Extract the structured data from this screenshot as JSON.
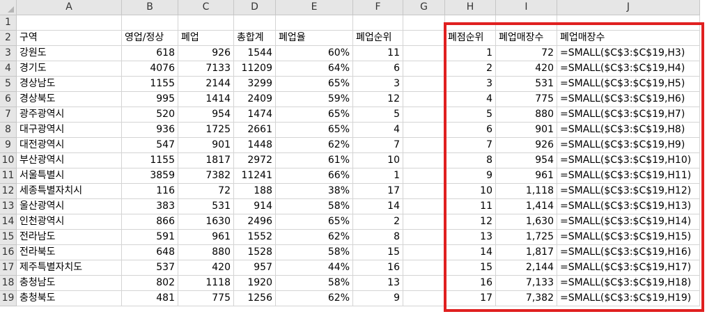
{
  "columns": [
    "A",
    "B",
    "C",
    "D",
    "E",
    "F",
    "G",
    "H",
    "I",
    "J"
  ],
  "accent_color": "#e02020",
  "rows": [
    {
      "n": "1",
      "A": "",
      "B": "",
      "C": "",
      "D": "",
      "E": "",
      "F": "",
      "G": "",
      "H": "",
      "I": "",
      "J": ""
    },
    {
      "n": "2",
      "A": "구역",
      "B": "영업/정상",
      "C": "폐업",
      "D": "총합계",
      "E": "폐업율",
      "F": "폐업순위",
      "G": "",
      "H": "폐점순위",
      "I": "폐업매장수",
      "J": "폐업매장수"
    },
    {
      "n": "3",
      "A": "강원도",
      "B": "618",
      "C": "926",
      "D": "1544",
      "E": "60%",
      "F": "11",
      "G": "",
      "H": "1",
      "I": "72",
      "J": "=SMALL($C$3:$C$19,H3)"
    },
    {
      "n": "4",
      "A": "경기도",
      "B": "4076",
      "C": "7133",
      "D": "11209",
      "E": "64%",
      "F": "6",
      "G": "",
      "H": "2",
      "I": "420",
      "J": "=SMALL($C$3:$C$19,H4)"
    },
    {
      "n": "5",
      "A": "경상남도",
      "B": "1155",
      "C": "2144",
      "D": "3299",
      "E": "65%",
      "F": "3",
      "G": "",
      "H": "3",
      "I": "531",
      "J": "=SMALL($C$3:$C$19,H5)"
    },
    {
      "n": "6",
      "A": "경상북도",
      "B": "995",
      "C": "1414",
      "D": "2409",
      "E": "59%",
      "F": "12",
      "G": "",
      "H": "4",
      "I": "775",
      "J": "=SMALL($C$3:$C$19,H6)"
    },
    {
      "n": "7",
      "A": "광주광역시",
      "B": "520",
      "C": "954",
      "D": "1474",
      "E": "65%",
      "F": "5",
      "G": "",
      "H": "5",
      "I": "880",
      "J": "=SMALL($C$3:$C$19,H7)"
    },
    {
      "n": "8",
      "A": "대구광역시",
      "B": "936",
      "C": "1725",
      "D": "2661",
      "E": "65%",
      "F": "4",
      "G": "",
      "H": "6",
      "I": "901",
      "J": "=SMALL($C$3:$C$19,H8)"
    },
    {
      "n": "9",
      "A": "대전광역시",
      "B": "547",
      "C": "901",
      "D": "1448",
      "E": "62%",
      "F": "7",
      "G": "",
      "H": "7",
      "I": "926",
      "J": "=SMALL($C$3:$C$19,H9)"
    },
    {
      "n": "10",
      "A": "부산광역시",
      "B": "1155",
      "C": "1817",
      "D": "2972",
      "E": "61%",
      "F": "10",
      "G": "",
      "H": "8",
      "I": "954",
      "J": "=SMALL($C$3:$C$19,H10)"
    },
    {
      "n": "11",
      "A": "서울특별시",
      "B": "3859",
      "C": "7382",
      "D": "11241",
      "E": "66%",
      "F": "1",
      "G": "",
      "H": "9",
      "I": "961",
      "J": "=SMALL($C$3:$C$19,H11)"
    },
    {
      "n": "12",
      "A": "세종특별자치시",
      "B": "116",
      "C": "72",
      "D": "188",
      "E": "38%",
      "F": "17",
      "G": "",
      "H": "10",
      "I": "1,118",
      "J": "=SMALL($C$3:$C$19,H12)"
    },
    {
      "n": "13",
      "A": "울산광역시",
      "B": "383",
      "C": "531",
      "D": "914",
      "E": "58%",
      "F": "14",
      "G": "",
      "H": "11",
      "I": "1,414",
      "J": "=SMALL($C$3:$C$19,H13)"
    },
    {
      "n": "14",
      "A": "인천광역시",
      "B": "866",
      "C": "1630",
      "D": "2496",
      "E": "65%",
      "F": "2",
      "G": "",
      "H": "12",
      "I": "1,630",
      "J": "=SMALL($C$3:$C$19,H14)"
    },
    {
      "n": "15",
      "A": "전라남도",
      "B": "591",
      "C": "961",
      "D": "1552",
      "E": "62%",
      "F": "8",
      "G": "",
      "H": "13",
      "I": "1,725",
      "J": "=SMALL($C$3:$C$19,H15)"
    },
    {
      "n": "16",
      "A": "전라북도",
      "B": "648",
      "C": "880",
      "D": "1528",
      "E": "58%",
      "F": "15",
      "G": "",
      "H": "14",
      "I": "1,817",
      "J": "=SMALL($C$3:$C$19,H16)"
    },
    {
      "n": "17",
      "A": "제주특별자치도",
      "B": "537",
      "C": "420",
      "D": "957",
      "E": "44%",
      "F": "16",
      "G": "",
      "H": "15",
      "I": "2,144",
      "J": "=SMALL($C$3:$C$19,H17)"
    },
    {
      "n": "18",
      "A": "충청남도",
      "B": "802",
      "C": "1118",
      "D": "1920",
      "E": "58%",
      "F": "13",
      "G": "",
      "H": "16",
      "I": "7,133",
      "J": "=SMALL($C$3:$C$19,H18)"
    },
    {
      "n": "19",
      "A": "충청북도",
      "B": "481",
      "C": "775",
      "D": "1256",
      "E": "62%",
      "F": "9",
      "G": "",
      "H": "17",
      "I": "7,382",
      "J": "=SMALL($C$3:$C$19,H19)"
    }
  ]
}
